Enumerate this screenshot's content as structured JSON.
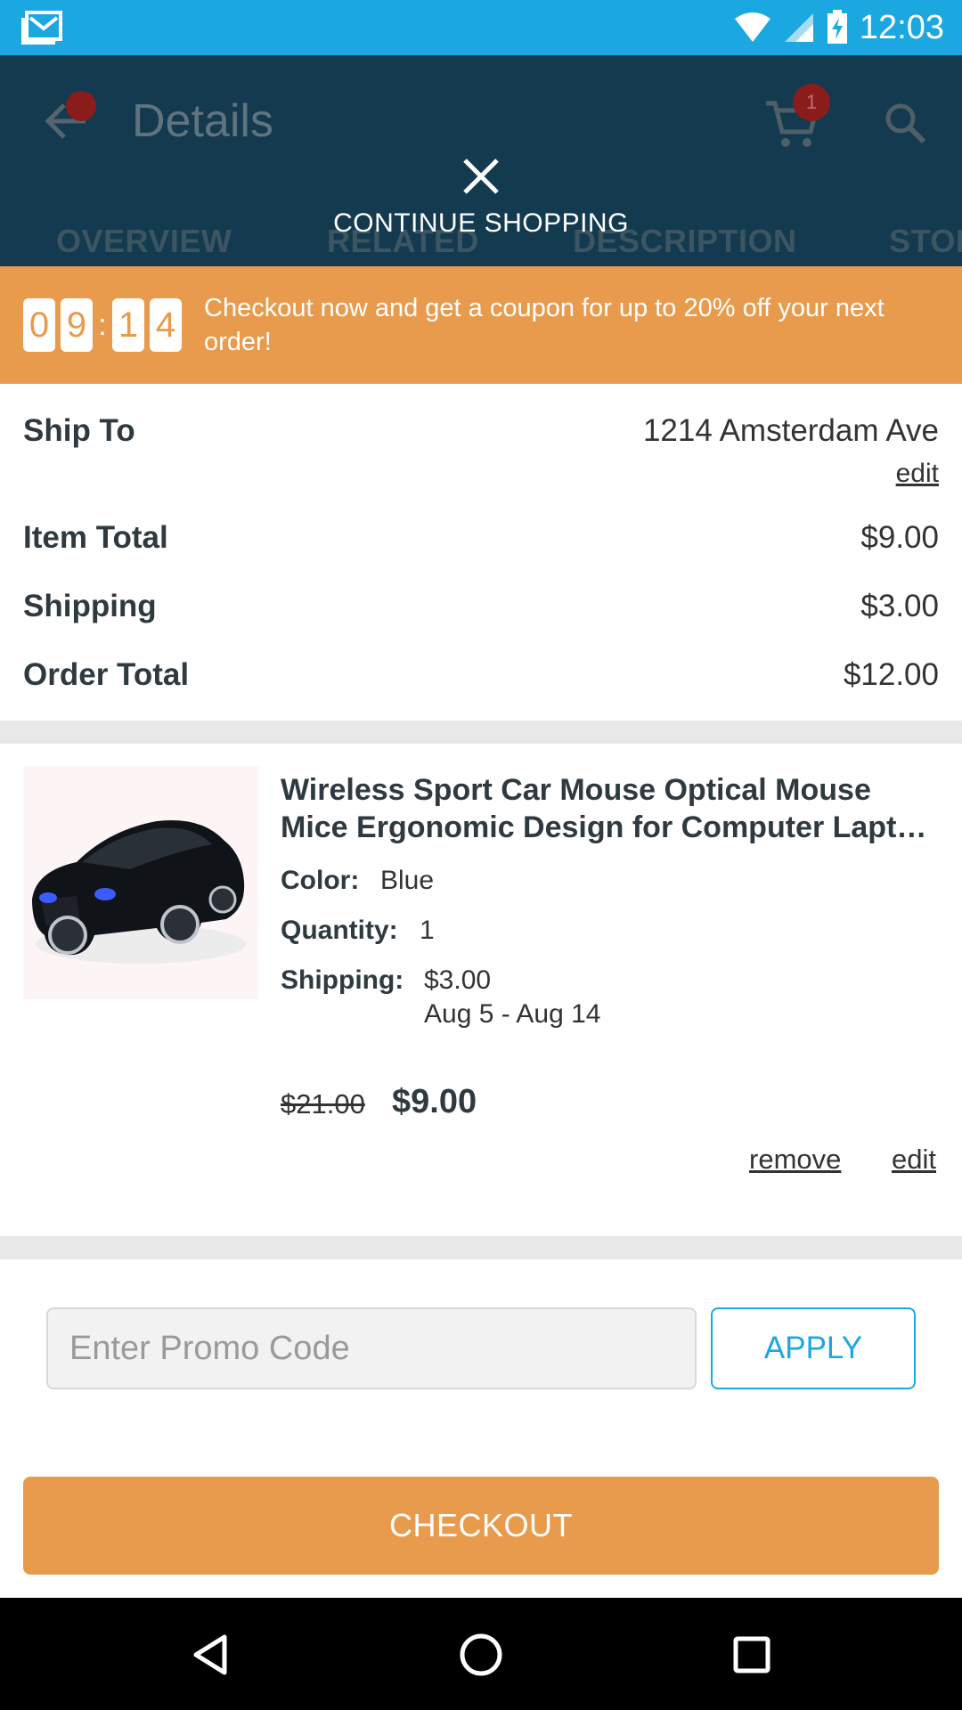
{
  "status_bar": {
    "time": "12:03"
  },
  "app_bar": {
    "title": "Details",
    "cart_badge": "1"
  },
  "tabs": [
    {
      "label": "OVERVIEW"
    },
    {
      "label": "RELATED"
    },
    {
      "label": "DESCRIPTION"
    },
    {
      "label": "STOR"
    }
  ],
  "overlay": {
    "label": "CONTINUE SHOPPING"
  },
  "promo_banner": {
    "timer_digits": [
      "0",
      "9",
      "1",
      "4"
    ],
    "separator": ":",
    "text": "Checkout now and get a coupon for up to 20% off your next order!"
  },
  "summary": {
    "ship_to_label": "Ship To",
    "ship_to_value": "1214 Amsterdam Ave",
    "edit_label": "edit",
    "item_total_label": "Item Total",
    "item_total_value": "$9.00",
    "shipping_label": "Shipping",
    "shipping_value": "$3.00",
    "order_total_label": "Order Total",
    "order_total_value": "$12.00"
  },
  "product": {
    "title": "Wireless Sport Car Mouse Optical Mouse Mice Ergonomic Design for Computer Lapt…",
    "color_label": "Color:",
    "color_value": "Blue",
    "quantity_label": "Quantity:",
    "quantity_value": "1",
    "shipping_label": "Shipping:",
    "shipping_value": "$3.00",
    "shipping_dates": "Aug 5 - Aug 14",
    "original_price": "$21.00",
    "price": "$9.00",
    "remove_label": "remove",
    "edit_label": "edit"
  },
  "promo": {
    "placeholder": "Enter Promo Code",
    "apply_label": "APPLY"
  },
  "checkout": {
    "label": "CHECKOUT"
  },
  "colors": {
    "status_bar": "#1ba8e0",
    "app_bar": "#133a4e",
    "accent_orange": "#e89b4d",
    "accent_blue": "#1ba8e0"
  }
}
